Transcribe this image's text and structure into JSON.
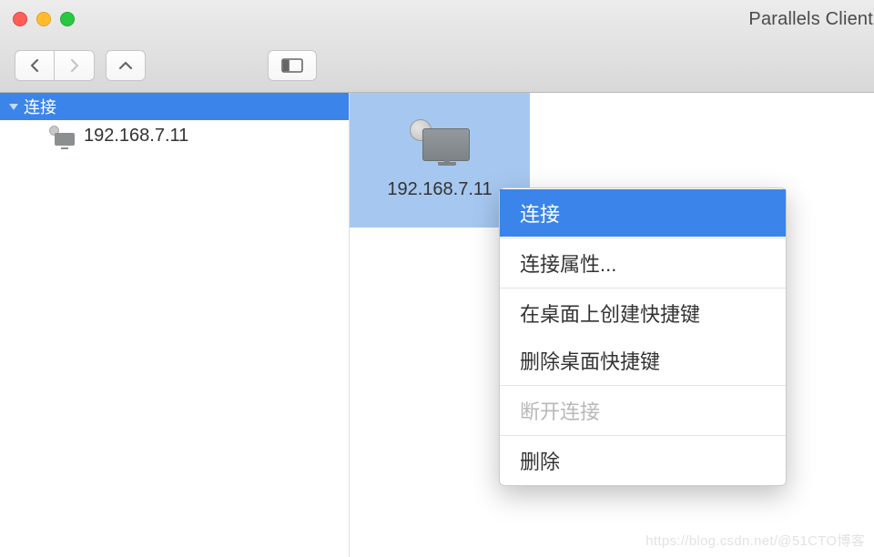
{
  "app": {
    "title": "Parallels Client"
  },
  "sidebar": {
    "header": "连接",
    "items": [
      {
        "label": "192.168.7.11"
      }
    ]
  },
  "main": {
    "connection": {
      "label": "192.168.7.11"
    }
  },
  "contextMenu": {
    "items": [
      {
        "label": "连接",
        "highlighted": true
      },
      {
        "label": "连接属性..."
      },
      {
        "label": "在桌面上创建快捷键"
      },
      {
        "label": "删除桌面快捷键"
      },
      {
        "label": "断开连接",
        "disabled": true
      },
      {
        "label": "删除"
      }
    ]
  },
  "watermark": "https://blog.csdn.net/@51CTO博客"
}
